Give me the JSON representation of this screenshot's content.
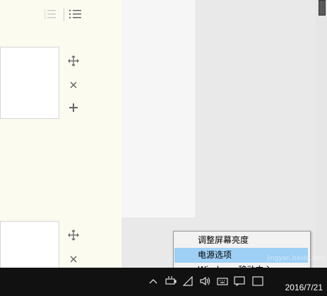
{
  "context_menu": {
    "items": [
      {
        "label": "调整屏幕亮度",
        "highlighted": false
      },
      {
        "label": "电源选项",
        "highlighted": true
      },
      {
        "label": "Windows 移动中心",
        "highlighted": false
      }
    ]
  },
  "taskbar": {
    "clock": "2016/7/21",
    "tray_icons": [
      "chevron-up-icon",
      "battery-icon",
      "wifi-icon",
      "volume-icon",
      "keyboard-icon",
      "action-center-icon",
      "input-method-icon"
    ]
  },
  "editor": {
    "toolbar_icons": [
      "numbered-list-icon",
      "bulleted-list-icon"
    ],
    "block_controls": [
      "move-icon",
      "delete-icon",
      "add-icon"
    ]
  },
  "watermark": "jingyan.baidu.com",
  "colors": {
    "editor_bg": "#fcfbf0",
    "menu_highlight": "#9ecff5",
    "taskbar_bg": "#111111"
  }
}
